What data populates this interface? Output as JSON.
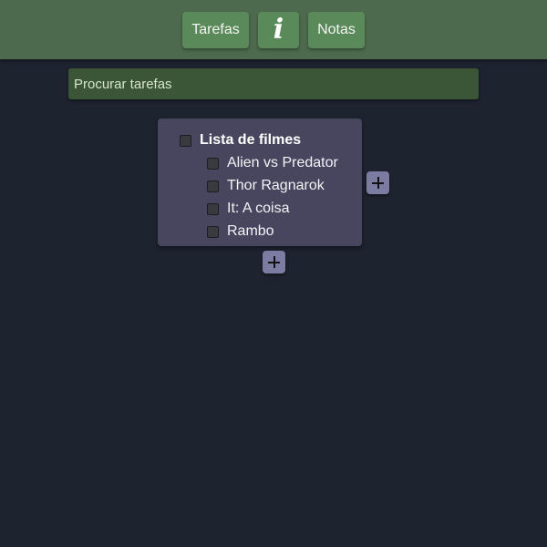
{
  "nav": {
    "tasks_label": "Tarefas",
    "info_icon": "info-icon",
    "info_glyph": "i",
    "notes_label": "Notas"
  },
  "search": {
    "placeholder": "Procurar tarefas",
    "value": ""
  },
  "task_list": {
    "title": "Lista de filmes",
    "items": [
      {
        "label": "Alien vs Predator",
        "checked": false
      },
      {
        "label": "Thor Ragnarok",
        "checked": false
      },
      {
        "label": "It: A coisa",
        "checked": false
      },
      {
        "label": "Rambo",
        "checked": false
      }
    ],
    "add_subtask_icon": "plus-icon",
    "add_task_icon": "plus-icon"
  },
  "colors": {
    "background": "#1e2330",
    "topbar": "#4e6a4e",
    "nav_button": "#5a8a5a",
    "search_bar": "#3b5537",
    "card": "#47465e",
    "add_button": "#7c7ba2"
  }
}
